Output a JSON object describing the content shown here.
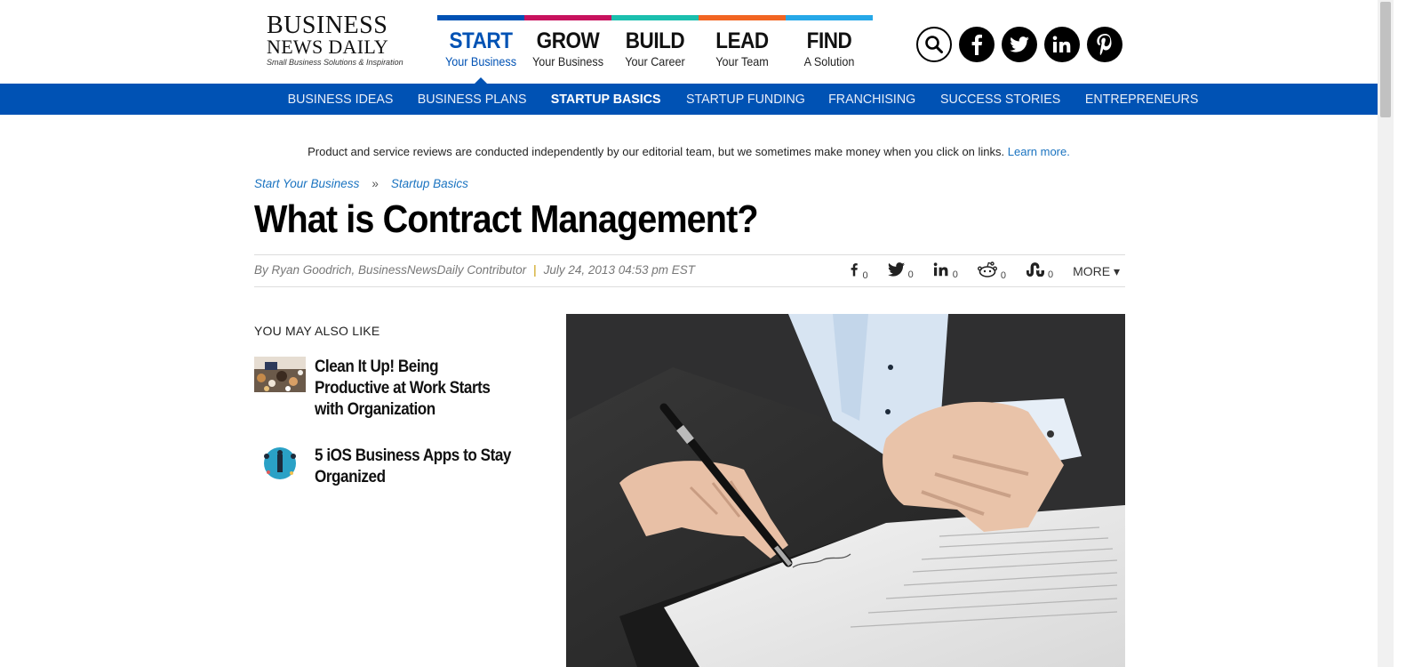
{
  "logo": {
    "line1": "BUSINESS",
    "line2": "NEWS DAILY",
    "tagline": "Small Business Solutions & Inspiration"
  },
  "pillars": [
    {
      "big": "START",
      "small": "Your Business",
      "color": "#0052b4"
    },
    {
      "big": "GROW",
      "small": "Your Business",
      "color": "#c8125e"
    },
    {
      "big": "BUILD",
      "small": "Your Career",
      "color": "#1bbfae"
    },
    {
      "big": "LEAD",
      "small": "Your Team",
      "color": "#f26522"
    },
    {
      "big": "FIND",
      "small": "A Solution",
      "color": "#26a8e8"
    }
  ],
  "header_icons": [
    "search-icon",
    "facebook-icon",
    "twitter-icon",
    "linkedin-icon",
    "pinterest-icon"
  ],
  "nav": {
    "items": [
      "BUSINESS IDEAS",
      "BUSINESS PLANS",
      "STARTUP BASICS",
      "STARTUP FUNDING",
      "FRANCHISING",
      "SUCCESS STORIES",
      "ENTREPRENEURS"
    ],
    "active": "STARTUP BASICS"
  },
  "disclaimer": {
    "text": "Product and service reviews are conducted independently by our editorial team, but we sometimes make money when you click on links.",
    "link": "Learn more."
  },
  "breadcrumb": {
    "items": [
      "Start Your Business",
      "Startup Basics"
    ],
    "separator": "»"
  },
  "article": {
    "title": "What is Contract Management?",
    "author": "By Ryan Goodrich, BusinessNewsDaily Contributor",
    "date": "July 24, 2013 04:53 pm EST"
  },
  "shares": [
    {
      "icon": "facebook-icon",
      "count": "0"
    },
    {
      "icon": "twitter-icon",
      "count": "0"
    },
    {
      "icon": "linkedin-icon",
      "count": "0"
    },
    {
      "icon": "reddit-icon",
      "count": "0"
    },
    {
      "icon": "stumbleupon-icon",
      "count": "0"
    }
  ],
  "more_label": "MORE",
  "aside": {
    "heading": "YOU MAY ALSO LIKE",
    "related": [
      {
        "title": "Clean It Up! Being Productive at Work Starts with Organization"
      },
      {
        "title": "5 iOS Business Apps to Stay Organized"
      }
    ]
  },
  "colors": {
    "brand_blue": "#0052b4",
    "link_blue": "#1a73c0"
  }
}
